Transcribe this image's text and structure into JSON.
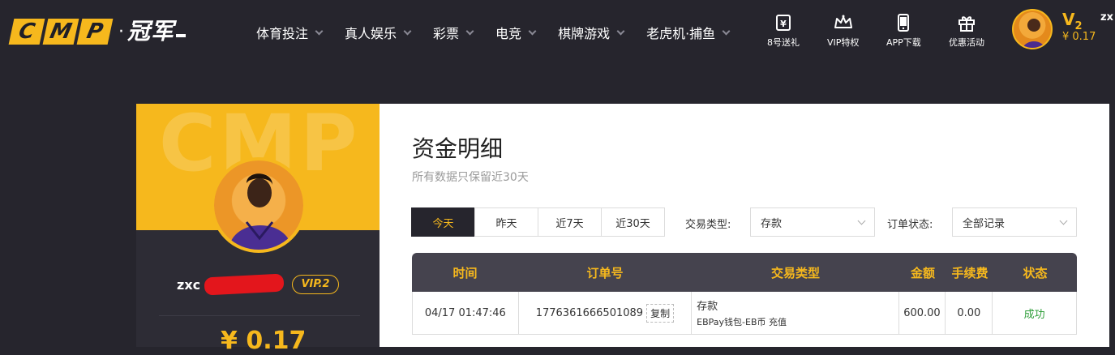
{
  "header": {
    "logo_letters": [
      "C",
      "M",
      "P"
    ],
    "logo_cn": "冠军",
    "nav": [
      {
        "label": "体育投注"
      },
      {
        "label": "真人娱乐"
      },
      {
        "label": "彩票"
      },
      {
        "label": "电竞"
      },
      {
        "label": "棋牌游戏"
      },
      {
        "label": "老虎机·捕鱼"
      }
    ],
    "quick_links": [
      {
        "label": "8号送礼",
        "icon": "ticket-icon"
      },
      {
        "label": "VIP特权",
        "icon": "crown-icon"
      },
      {
        "label": "APP下载",
        "icon": "phone-icon"
      },
      {
        "label": "优惠活动",
        "icon": "gift-icon"
      }
    ],
    "vip_level": "V",
    "vip_num": "2",
    "balance": "¥ 0.17",
    "username_short": "zx"
  },
  "profile": {
    "banner_bg_text": "CMP",
    "username": "zxc",
    "vip_badge": "VIP.2",
    "balance": "¥ 0.17"
  },
  "main": {
    "title": "资金明细",
    "subtitle": "所有数据只保留近30天",
    "tabs": [
      {
        "label": "今天",
        "active": true
      },
      {
        "label": "昨天",
        "active": false
      },
      {
        "label": "近7天",
        "active": false
      },
      {
        "label": "近30天",
        "active": false
      }
    ],
    "filters": {
      "type_label": "交易类型:",
      "type_value": "存款",
      "status_label": "订单状态:",
      "status_value": "全部记录"
    },
    "table": {
      "headers": [
        "时间",
        "订单号",
        "交易类型",
        "金额",
        "手续费",
        "状态"
      ],
      "rows": [
        {
          "time": "04/17 01:47:46",
          "order_no": "1776361666501089",
          "copy": "复制",
          "type": "存款",
          "type_detail": "EBPay钱包-EB币 充值",
          "amount": "600.00",
          "fee": "0.00",
          "status": "成功"
        }
      ]
    }
  },
  "colors": {
    "accent": "#f6b81d",
    "background": "#26252d",
    "success": "#2f9e3a"
  }
}
